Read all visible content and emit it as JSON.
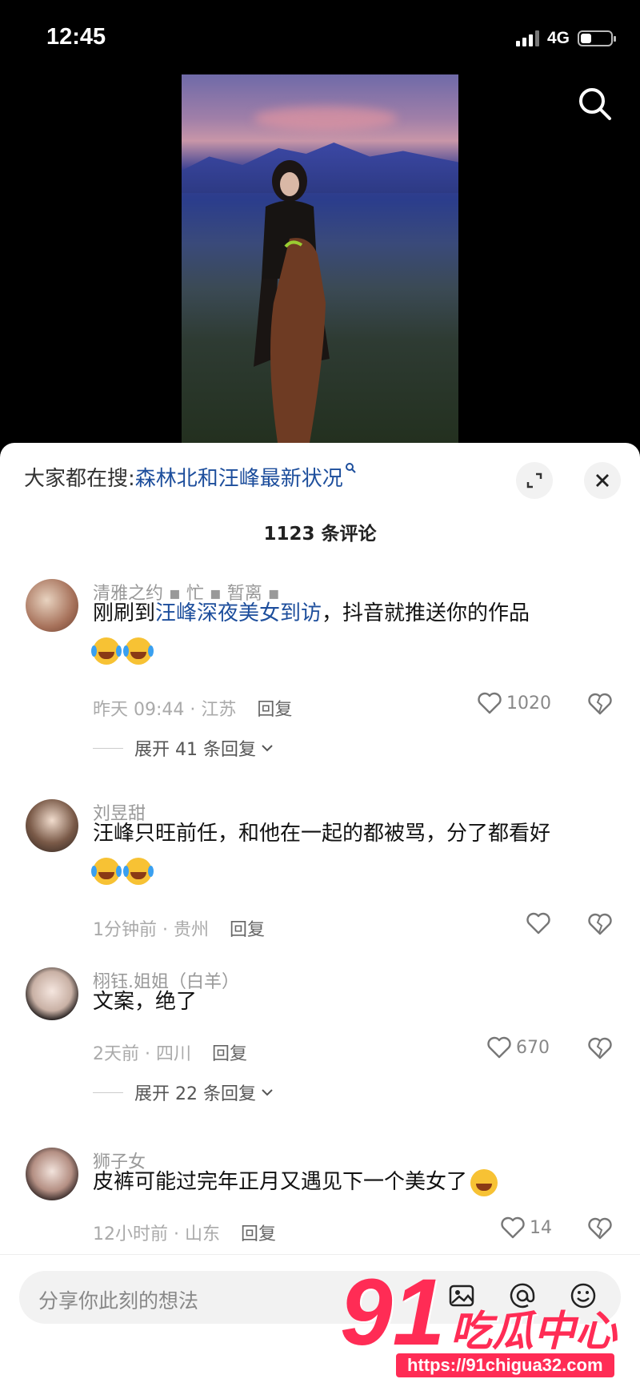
{
  "status_bar": {
    "time": "12:45",
    "network": "4G",
    "battery_level": 0.35
  },
  "video": {
    "search_icon": "search-icon"
  },
  "sheet": {
    "hot_search_label": "大家都在搜:",
    "hot_search_query": "森林北和汪峰最新状况",
    "comment_count": "1123 条评论"
  },
  "comments": [
    {
      "username": "清雅之约 ▪ 忙 ▪ 暂离 ▪",
      "text_before": "刚刷到",
      "text_link": "汪峰深夜美女到访",
      "text_after": "，抖音就推送你的作品",
      "emoji": "laugh-cry x2",
      "time_location": "昨天 09:44 · 江苏",
      "reply": "回复",
      "likes": "1020",
      "expand": "展开 41 条回复"
    },
    {
      "username": "刘昱甜",
      "text": "汪峰只旺前任，和他在一起的都被骂，分了都看好",
      "emoji": "laugh-cry x2",
      "time_location": "1分钟前 · 贵州",
      "reply": "回复",
      "likes": ""
    },
    {
      "username": "栩钰.姐姐（白羊）",
      "text": "文案，绝了",
      "time_location": "2天前 · 四川",
      "reply": "回复",
      "likes": "670",
      "expand": "展开 22 条回复"
    },
    {
      "username": "狮子女",
      "text": "皮裤可能过完年正月又遇见下一个美女了",
      "emoji": "grin-sweat",
      "time_location": "12小时前 · 山东",
      "reply": "回复",
      "likes": "14"
    }
  ],
  "input": {
    "placeholder": "分享你此刻的想法"
  },
  "watermark": {
    "brand_number": "91",
    "brand_text": "吃瓜中心",
    "url": "https://91chigua32.com"
  },
  "colors": {
    "link": "#1d4e9c",
    "watermark": "#ff2c55"
  }
}
